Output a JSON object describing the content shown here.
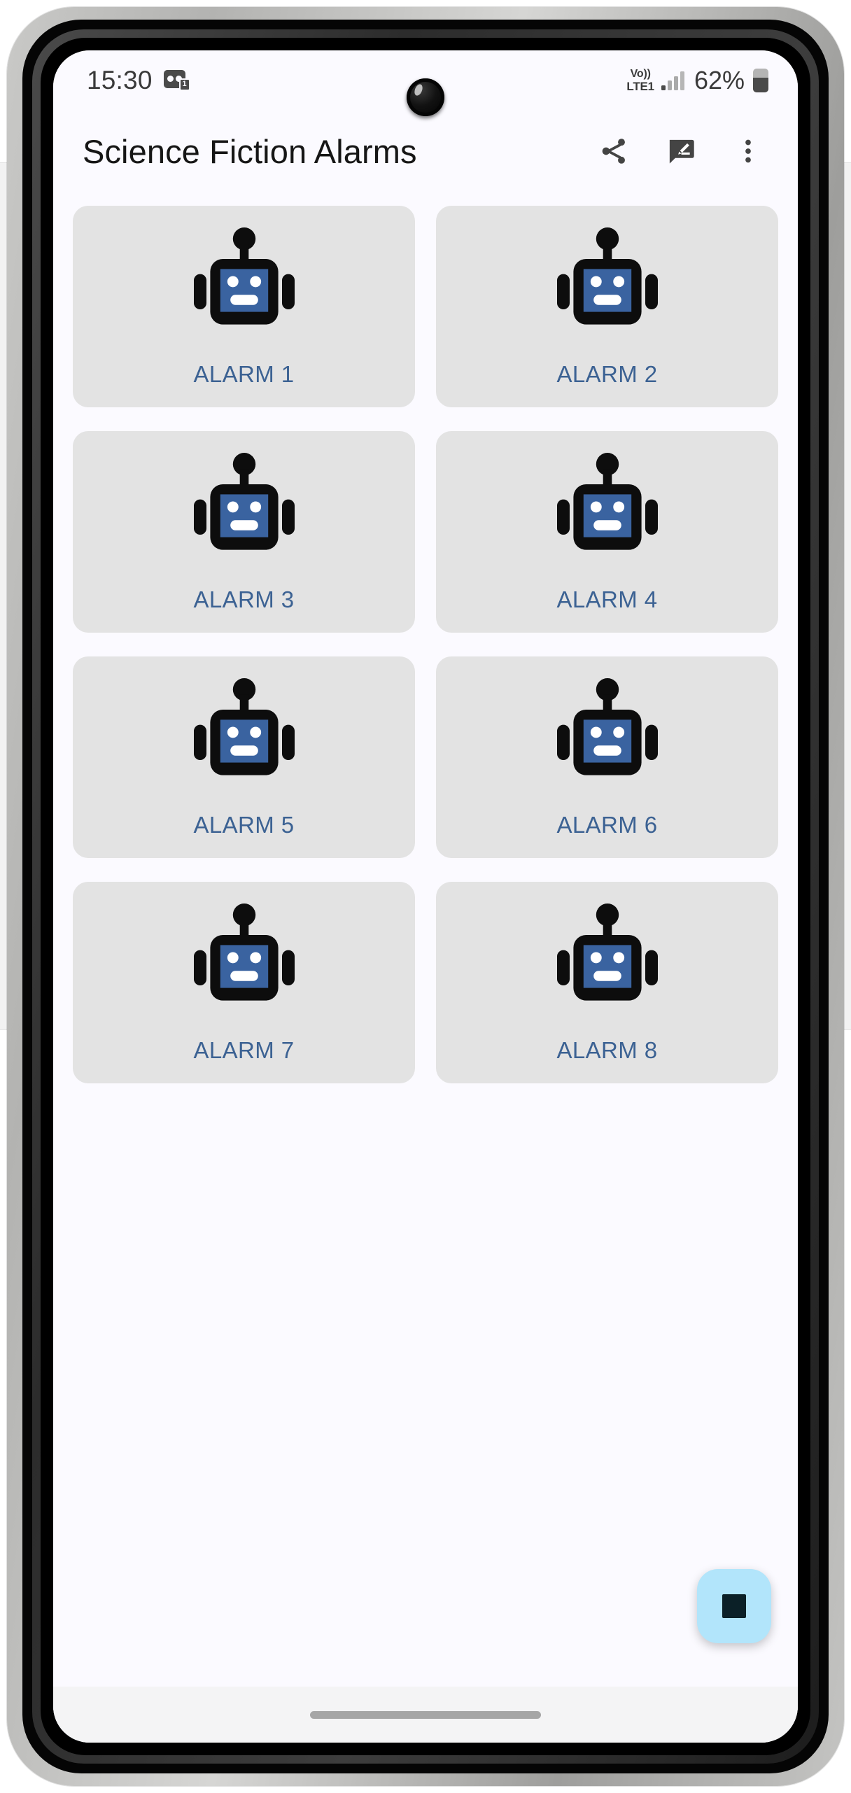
{
  "status_bar": {
    "time": "15:30",
    "voicemail_count": "1",
    "voicemail_icon": "voicemail-icon",
    "network_line1": "Vo))",
    "network_line2": "LTE1",
    "signal_icon": "signal-bars-icon",
    "battery_percent": "62%",
    "battery_icon": "battery-icon",
    "camera_icon": "front-camera-icon"
  },
  "app_bar": {
    "title": "Science Fiction Alarms",
    "actions": [
      {
        "name": "share-button",
        "icon": "share-icon"
      },
      {
        "name": "rate-review-button",
        "icon": "rate-review-icon"
      },
      {
        "name": "overflow-menu-button",
        "icon": "more-vert-icon"
      }
    ]
  },
  "grid": {
    "items": [
      {
        "label": "ALARM 1",
        "icon": "robot-icon"
      },
      {
        "label": "ALARM 2",
        "icon": "robot-icon"
      },
      {
        "label": "ALARM 3",
        "icon": "robot-icon"
      },
      {
        "label": "ALARM 4",
        "icon": "robot-icon"
      },
      {
        "label": "ALARM 5",
        "icon": "robot-icon"
      },
      {
        "label": "ALARM 6",
        "icon": "robot-icon"
      },
      {
        "label": "ALARM 7",
        "icon": "robot-icon"
      },
      {
        "label": "ALARM 8",
        "icon": "robot-icon"
      }
    ]
  },
  "fab": {
    "name": "stop-button",
    "icon": "stop-square-icon"
  },
  "nav": {
    "gesture_bar": "home-gesture-bar"
  },
  "colors": {
    "screen_background": "#fbfaff",
    "card_background": "#e3e3e3",
    "label_blue": "#3c6293",
    "robot_face_blue": "#3a63a0",
    "robot_outline": "#0d0d0d",
    "fab_background": "#b2e5fb",
    "fab_icon": "#0b2027",
    "title_text": "#161616",
    "status_text": "#3a3a3a",
    "nav_background": "#f4f4f5",
    "gesture_bar": "#a6a6a6"
  }
}
